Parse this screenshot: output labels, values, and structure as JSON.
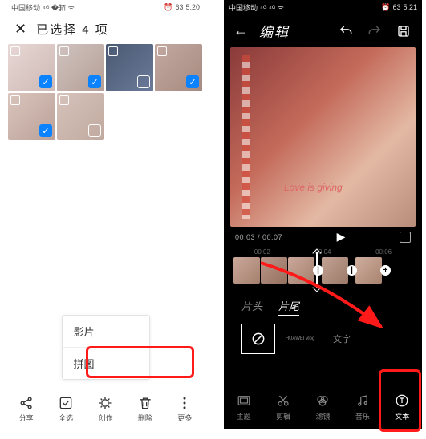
{
  "left": {
    "status": {
      "carrier": "中国移动",
      "indicators": "⁴ᴳ �筘 ᯤ",
      "alarm": "⏰",
      "battery": "63",
      "time": "5:20"
    },
    "header": {
      "close": "✕",
      "title": "已选择 4 项"
    },
    "thumbs": [
      {
        "cls": "a",
        "checked": true
      },
      {
        "cls": "b",
        "checked": true
      },
      {
        "cls": "c",
        "checked": false
      },
      {
        "cls": "d",
        "checked": true
      },
      {
        "cls": "e",
        "checked": true
      },
      {
        "cls": "f",
        "checked": false
      }
    ],
    "popup": {
      "item1": "影片",
      "item2": "拼图"
    },
    "bottom": [
      {
        "label": "分享"
      },
      {
        "label": "全选"
      },
      {
        "label": "创作"
      },
      {
        "label": "删除"
      },
      {
        "label": "更多"
      }
    ]
  },
  "right": {
    "status": {
      "carrier": "中国移动",
      "indicators": "⁴ᴳ ⁴ᴳ ᯤ",
      "alarm": "⏰",
      "battery": "63",
      "time": "5:21"
    },
    "header": {
      "back": "←",
      "title": "编辑"
    },
    "preview_caption": "Love is giving",
    "time": "00:03 / 00:07",
    "ruler": [
      "00:02",
      "",
      "00:04",
      "",
      "00:06"
    ],
    "seg": {
      "tab1": "片头",
      "tab2": "片尾"
    },
    "styles": {
      "none": "⊘",
      "s1": "HUAWEI vlog",
      "s2": "文字"
    },
    "bottom": [
      {
        "label": "主题"
      },
      {
        "label": "剪辑"
      },
      {
        "label": "滤镜"
      },
      {
        "label": "音乐"
      },
      {
        "label": "文本"
      }
    ]
  }
}
